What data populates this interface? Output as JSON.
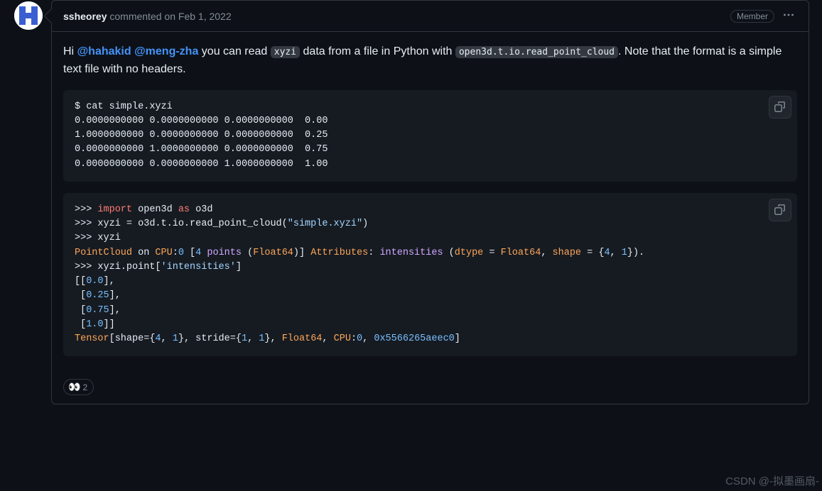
{
  "comment": {
    "author": "ssheorey",
    "action_verb": "commented",
    "time_preposition": "on",
    "date": "Feb 1, 2022",
    "badge": "Member"
  },
  "body": {
    "greeting": "Hi",
    "mention1": "@hahakid",
    "mention2": "@meng-zha",
    "seg1": " you can read ",
    "code1": "xyzi",
    "seg2": " data from a file in Python with ",
    "code2": "open3d.t.io.read_point_cloud",
    "seg3": ". Note that the format is a simple text file with no headers."
  },
  "code_block1": "$ cat simple.xyzi\n0.0000000000 0.0000000000 0.0000000000  0.00\n1.0000000000 0.0000000000 0.0000000000  0.25\n0.0000000000 1.0000000000 0.0000000000  0.75\n0.0000000000 0.0000000000 1.0000000000  1.00",
  "code2": {
    "l1_prompt": ">>> ",
    "l1_import": "import",
    "l1_open3d": " open3d ",
    "l1_as": "as",
    "l1_o3d": " o3d",
    "l2_prompt": ">>> ",
    "l2_text": "xyzi = o3d.t.io.read_point_cloud(",
    "l2_str": "\"simple.xyzi\"",
    "l2_end": ")",
    "l3_prompt": ">>> ",
    "l3_text": "xyzi",
    "l4_pc": "PointCloud",
    "l4_on": " on ",
    "l4_cpu": "CPU",
    "l4_colon": ":",
    "l4_zero": "0",
    "l4_sp": " [",
    "l4_four": "4",
    "l4_points": " points ",
    "l4_paren": "(",
    "l4_float": "Float64",
    "l4_cparen": ")] ",
    "l4_attr": "Attributes",
    "l4_col2": ": ",
    "l4_int": "intensities",
    "l4_sp2": " (",
    "l4_dtype": "dtype",
    "l4_eq": " = ",
    "l4_float2": "Float64",
    "l4_comma": ", ",
    "l4_shape": "shape",
    "l4_eq2": " = {",
    "l4_four2": "4",
    "l4_comma2": ", ",
    "l4_one": "1",
    "l4_end": "}).",
    "l5_prompt": ">>> ",
    "l5_text": "xyzi.point[",
    "l5_str": "'intensities'",
    "l5_end": "]",
    "l6_a": "[[",
    "l6_n": "0.0",
    "l6_b": "],",
    "l7_a": " [",
    "l7_n": "0.25",
    "l7_b": "],",
    "l8_a": " [",
    "l8_n": "0.75",
    "l8_b": "],",
    "l9_a": " [",
    "l9_n": "1.0",
    "l9_b": "]]",
    "l10_tensor": "Tensor",
    "l10_a": "[shape={",
    "l10_4": "4",
    "l10_c1": ", ",
    "l10_1": "1",
    "l10_b": "}, stride={",
    "l10_1b": "1",
    "l10_c2": ", ",
    "l10_1c": "1",
    "l10_c": "}, ",
    "l10_float": "Float64",
    "l10_c3": ", ",
    "l10_cpu": "CPU",
    "l10_col": ":",
    "l10_0": "0",
    "l10_c4": ", ",
    "l10_hex": "0x5566265aeec0",
    "l10_end": "]"
  },
  "reaction": {
    "emoji": "👀",
    "count": "2"
  },
  "watermark": "CSDN @-拟墨画扇-"
}
